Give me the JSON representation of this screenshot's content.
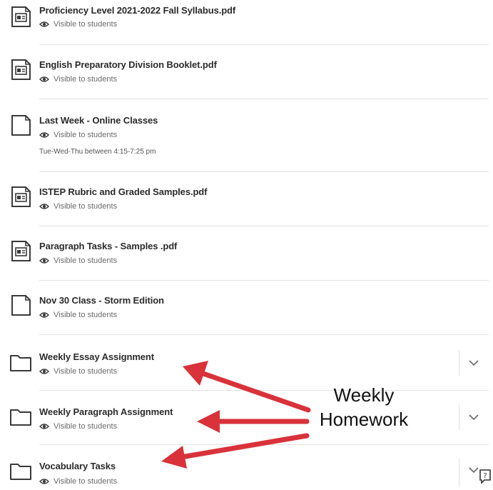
{
  "items": [
    {
      "kind": "pdf",
      "title": "Proficiency Level 2021-2022 Fall Syllabus.pdf",
      "visibility": "Visible to students"
    },
    {
      "kind": "pdf",
      "title": "English Preparatory Division Booklet.pdf",
      "visibility": "Visible to students"
    },
    {
      "kind": "doc",
      "title": "Last Week - Online Classes",
      "visibility": "Visible to students",
      "extra": "Tue-Wed-Thu between 4:15-7:25 pm"
    },
    {
      "kind": "pdf",
      "title": "ISTEP Rubric and Graded Samples.pdf",
      "visibility": "Visible to students"
    },
    {
      "kind": "pdf",
      "title": "Paragraph Tasks - Samples .pdf",
      "visibility": "Visible to students"
    },
    {
      "kind": "doc",
      "title": "Nov 30 Class - Storm Edition",
      "visibility": "Visible to students"
    },
    {
      "kind": "folder",
      "title": "Weekly Essay Assignment",
      "visibility": "Visible to students"
    },
    {
      "kind": "folder",
      "title": "Weekly Paragraph Assignment",
      "visibility": "Visible to students"
    },
    {
      "kind": "folder",
      "title": "Vocabulary Tasks",
      "visibility": "Visible to students"
    }
  ],
  "annotation": {
    "line1": "Weekly",
    "line2": "Homework",
    "arrow_color": "#d9323a"
  },
  "icons": {
    "pdf": "pdf-file-icon",
    "doc": "document-icon",
    "folder": "folder-icon",
    "eye": "eye-icon",
    "chevron": "chevron-down-icon",
    "help": "help-icon"
  }
}
